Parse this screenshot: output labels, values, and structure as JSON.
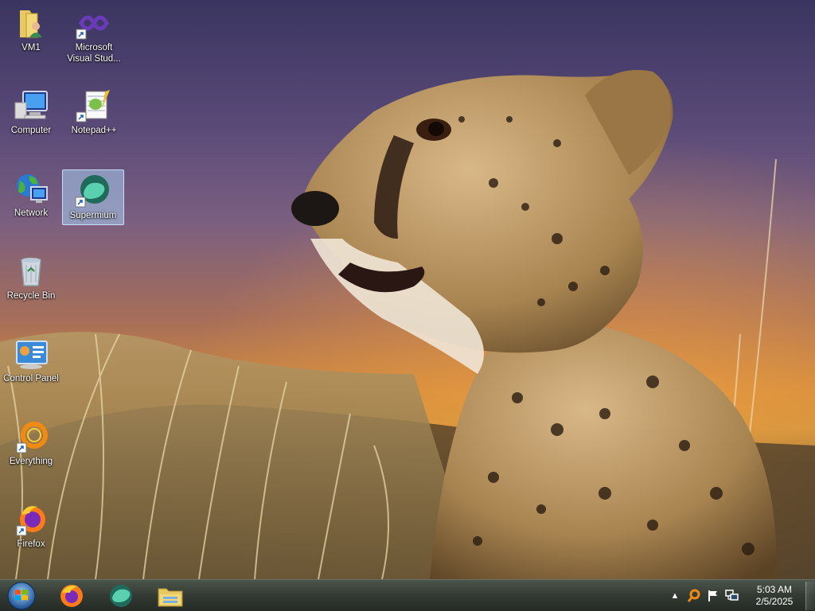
{
  "desktop": {
    "icons": [
      {
        "label": "VM1"
      },
      {
        "label": "Microsoft Visual Stud..."
      },
      {
        "label": "Computer"
      },
      {
        "label": "Notepad++"
      },
      {
        "label": "Network"
      },
      {
        "label": "Supermium"
      },
      {
        "label": "Recycle Bin"
      },
      {
        "label": "Control Panel"
      },
      {
        "label": "Everything"
      },
      {
        "label": "Firefox"
      }
    ]
  },
  "taskbar": {
    "pinned": [
      {
        "icon": "firefox-icon"
      },
      {
        "icon": "supermium-icon"
      },
      {
        "icon": "file-explorer-icon"
      }
    ],
    "clock": {
      "time": "5:03 AM",
      "date": "2/5/2025"
    }
  }
}
